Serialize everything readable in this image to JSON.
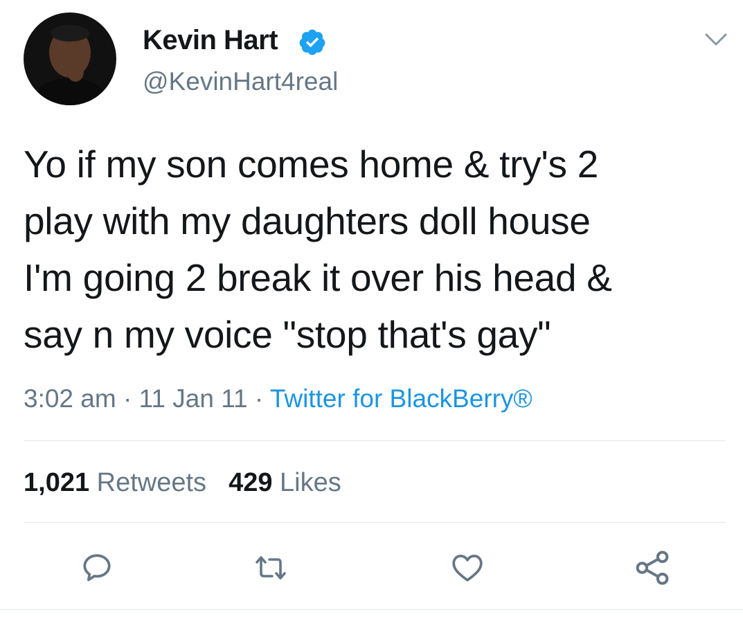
{
  "user": {
    "display_name": "Kevin Hart",
    "handle": "@KevinHart4real",
    "verified": true
  },
  "tweet": {
    "lines": [
      "Yo if my son comes home & try's 2",
      "play with my daughters doll house",
      "I'm going 2 break it over his head &",
      "say n my voice \"stop that's gay\""
    ]
  },
  "meta": {
    "time": "3:02 am",
    "separator": " · ",
    "date": "11 Jan 11",
    "source": "Twitter for BlackBerry®"
  },
  "stats": {
    "retweets_count": "1,021",
    "retweets_label": "Retweets",
    "likes_count": "429",
    "likes_label": "Likes"
  },
  "actions": [
    {
      "icon": "reply-icon"
    },
    {
      "icon": "retweet-icon"
    },
    {
      "icon": "like-icon"
    },
    {
      "icon": "share-icon"
    }
  ],
  "colors": {
    "primary_text": "#14171a",
    "secondary_text": "#657786",
    "link": "#1b95e0",
    "verified_badge": "#1da1f2",
    "divider": "#e1e8ed"
  }
}
